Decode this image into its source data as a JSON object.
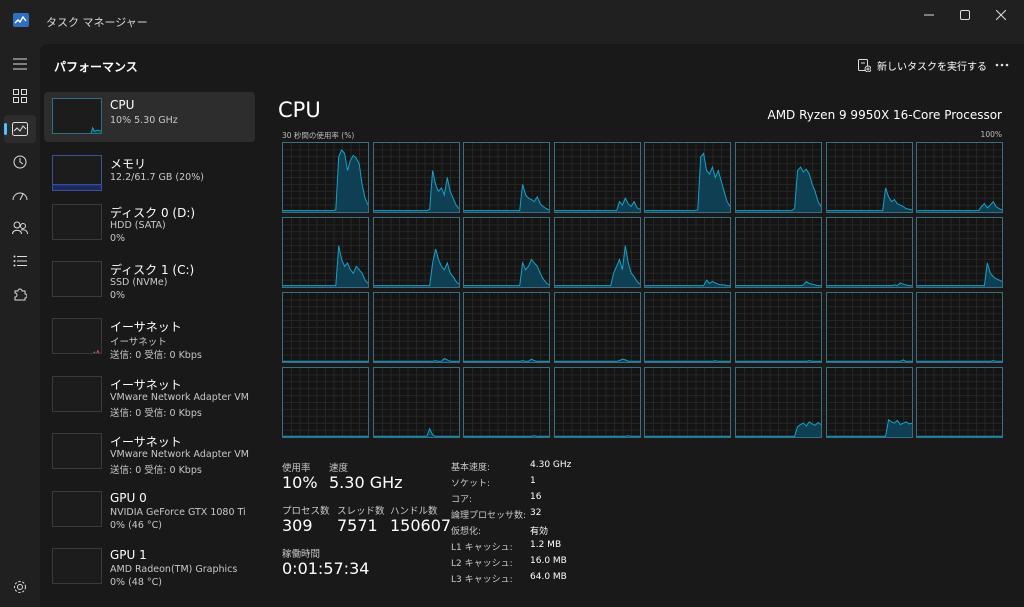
{
  "window": {
    "title": "タスク マネージャー"
  },
  "header": {
    "title": "パフォーマンス",
    "run_task_label": "新しいタスクを実行する"
  },
  "sidebar": {
    "items": [
      {
        "name": "CPU",
        "sub1": "10% 5.30 GHz",
        "sub2": ""
      },
      {
        "name": "メモリ",
        "sub1": "12.2/61.7 GB (20%)",
        "sub2": ""
      },
      {
        "name": "ディスク 0 (D:)",
        "sub1": "HDD (SATA)",
        "sub2": "0%"
      },
      {
        "name": "ディスク 1 (C:)",
        "sub1": "SSD (NVMe)",
        "sub2": "0%"
      },
      {
        "name": "イーサネット",
        "sub1": "イーサネット",
        "sub2": "送信: 0 受信: 0 Kbps"
      },
      {
        "name": "イーサネット",
        "sub1": "VMware Network Adapter VM...",
        "sub2": "送信: 0 受信: 0 Kbps"
      },
      {
        "name": "イーサネット",
        "sub1": "VMware Network Adapter VM...",
        "sub2": "送信: 0 受信: 0 Kbps"
      },
      {
        "name": "GPU 0",
        "sub1": "NVIDIA GeForce GTX 1080 Ti",
        "sub2": "0% (46 °C)"
      },
      {
        "name": "GPU 1",
        "sub1": "AMD Radeon(TM) Graphics",
        "sub2": "0% (48 °C)"
      }
    ]
  },
  "main": {
    "title": "CPU",
    "model": "AMD Ryzen 9 9950X 16-Core Processor",
    "graph_label_left": "30 秒間の使用率 (%)",
    "graph_label_right": "100%"
  },
  "stats": {
    "usage_label": "使用率",
    "usage_value": "10%",
    "speed_label": "速度",
    "speed_value": "5.30 GHz",
    "processes_label": "プロセス数",
    "processes_value": "309",
    "threads_label": "スレッド数",
    "threads_value": "7571",
    "handles_label": "ハンドル数",
    "handles_value": "150607",
    "uptime_label": "稼働時間",
    "uptime_value": "0:01:57:34"
  },
  "specs": [
    {
      "key": "基本速度:",
      "value": "4.30 GHz"
    },
    {
      "key": "ソケット:",
      "value": "1"
    },
    {
      "key": "コア:",
      "value": "16"
    },
    {
      "key": "論理プロセッサ数:",
      "value": "32"
    },
    {
      "key": "仮想化:",
      "value": "有効"
    },
    {
      "key": "L1 キャッシュ:",
      "value": "1.2 MB"
    },
    {
      "key": "L2 キャッシュ:",
      "value": "16.0 MB"
    },
    {
      "key": "L3 キャッシュ:",
      "value": "64.0 MB"
    }
  ],
  "colors": {
    "cpu_line": "#17a0c8",
    "cpu_fill": "#0f3f52",
    "memory": "#3a5ccc",
    "network": "#c85078",
    "accent": "#4cc2ff"
  },
  "cpu_cores": [
    [
      2,
      2,
      2,
      2,
      2,
      2,
      2,
      2,
      2,
      2,
      2,
      2,
      2,
      2,
      2,
      2,
      2,
      2,
      3,
      80,
      90,
      85,
      60,
      75,
      82,
      78,
      70,
      40,
      20,
      10
    ],
    [
      2,
      2,
      2,
      2,
      2,
      2,
      2,
      2,
      2,
      2,
      2,
      2,
      2,
      2,
      2,
      2,
      2,
      2,
      2,
      4,
      60,
      40,
      30,
      35,
      25,
      50,
      30,
      20,
      10,
      5
    ],
    [
      2,
      2,
      2,
      2,
      2,
      2,
      2,
      2,
      2,
      2,
      2,
      2,
      2,
      2,
      2,
      2,
      2,
      2,
      2,
      2,
      40,
      25,
      20,
      18,
      15,
      22,
      12,
      8,
      5,
      3
    ],
    [
      2,
      2,
      2,
      2,
      2,
      2,
      2,
      2,
      2,
      2,
      2,
      2,
      2,
      2,
      2,
      2,
      2,
      2,
      2,
      2,
      2,
      2,
      15,
      10,
      20,
      12,
      8,
      15,
      6,
      4
    ],
    [
      2,
      2,
      2,
      2,
      2,
      2,
      2,
      2,
      2,
      2,
      2,
      2,
      2,
      2,
      2,
      2,
      2,
      2,
      3,
      80,
      85,
      60,
      55,
      65,
      50,
      60,
      45,
      30,
      15,
      8
    ],
    [
      2,
      2,
      2,
      2,
      2,
      2,
      2,
      2,
      2,
      2,
      2,
      2,
      2,
      2,
      2,
      2,
      2,
      2,
      2,
      2,
      5,
      60,
      65,
      58,
      62,
      55,
      40,
      30,
      15,
      8
    ],
    [
      2,
      2,
      2,
      2,
      2,
      2,
      2,
      2,
      2,
      2,
      2,
      2,
      2,
      2,
      2,
      2,
      2,
      2,
      2,
      2,
      35,
      22,
      15,
      18,
      12,
      10,
      8,
      5,
      4,
      3
    ],
    [
      2,
      2,
      2,
      2,
      2,
      2,
      2,
      2,
      2,
      2,
      2,
      2,
      2,
      2,
      2,
      2,
      2,
      2,
      2,
      2,
      2,
      2,
      8,
      12,
      6,
      10,
      15,
      8,
      5,
      3
    ],
    [
      2,
      2,
      2,
      2,
      2,
      2,
      2,
      2,
      2,
      2,
      2,
      2,
      2,
      2,
      2,
      2,
      2,
      2,
      2,
      60,
      40,
      30,
      35,
      25,
      20,
      30,
      25,
      20,
      10,
      5
    ],
    [
      2,
      2,
      2,
      2,
      2,
      2,
      2,
      2,
      2,
      2,
      2,
      2,
      2,
      2,
      2,
      2,
      2,
      2,
      2,
      2,
      35,
      55,
      40,
      30,
      25,
      35,
      20,
      15,
      8,
      4
    ],
    [
      2,
      2,
      2,
      2,
      2,
      2,
      2,
      2,
      2,
      2,
      2,
      2,
      2,
      2,
      2,
      2,
      2,
      2,
      2,
      2,
      35,
      25,
      30,
      40,
      35,
      30,
      20,
      12,
      6,
      3
    ],
    [
      2,
      2,
      2,
      2,
      2,
      2,
      2,
      2,
      2,
      2,
      2,
      2,
      2,
      2,
      2,
      2,
      2,
      2,
      2,
      2,
      20,
      30,
      40,
      25,
      60,
      35,
      20,
      15,
      8,
      4
    ],
    [
      2,
      2,
      2,
      2,
      2,
      2,
      2,
      2,
      2,
      2,
      2,
      2,
      2,
      2,
      2,
      2,
      2,
      2,
      2,
      2,
      2,
      10,
      5,
      8,
      6,
      4,
      3,
      3,
      2,
      2
    ],
    [
      2,
      2,
      2,
      2,
      2,
      2,
      2,
      2,
      2,
      2,
      2,
      2,
      2,
      2,
      2,
      2,
      2,
      2,
      2,
      2,
      2,
      2,
      2,
      3,
      8,
      5,
      4,
      3,
      2,
      2
    ],
    [
      2,
      2,
      2,
      2,
      2,
      2,
      2,
      2,
      2,
      2,
      2,
      2,
      2,
      2,
      2,
      2,
      2,
      2,
      2,
      2,
      2,
      2,
      2,
      3,
      2,
      6,
      4,
      3,
      2,
      2
    ],
    [
      2,
      2,
      2,
      2,
      2,
      2,
      2,
      2,
      2,
      2,
      2,
      2,
      2,
      2,
      2,
      2,
      2,
      2,
      2,
      2,
      2,
      2,
      2,
      2,
      35,
      20,
      15,
      12,
      10,
      8
    ],
    [
      1,
      1,
      1,
      1,
      1,
      1,
      1,
      1,
      1,
      1,
      1,
      1,
      1,
      1,
      1,
      1,
      1,
      1,
      1,
      1,
      1,
      1,
      1,
      1,
      1,
      1,
      1,
      1,
      1,
      1
    ],
    [
      1,
      1,
      1,
      1,
      1,
      1,
      1,
      1,
      1,
      1,
      1,
      1,
      1,
      1,
      1,
      1,
      1,
      1,
      1,
      1,
      1,
      2,
      1,
      1,
      5,
      3,
      1,
      1,
      1,
      1
    ],
    [
      1,
      1,
      1,
      1,
      1,
      1,
      1,
      1,
      1,
      1,
      1,
      1,
      1,
      1,
      1,
      1,
      1,
      1,
      1,
      1,
      2,
      1,
      1,
      4,
      2,
      1,
      1,
      1,
      1,
      1
    ],
    [
      1,
      1,
      1,
      1,
      1,
      1,
      1,
      1,
      1,
      1,
      1,
      1,
      1,
      1,
      1,
      1,
      1,
      1,
      1,
      1,
      1,
      1,
      2,
      4,
      3,
      1,
      1,
      1,
      1,
      1
    ],
    [
      1,
      1,
      1,
      1,
      1,
      1,
      1,
      1,
      1,
      1,
      1,
      1,
      1,
      1,
      1,
      1,
      1,
      1,
      1,
      1,
      1,
      1,
      1,
      1,
      2,
      1,
      1,
      1,
      1,
      1
    ],
    [
      1,
      1,
      1,
      1,
      1,
      1,
      1,
      1,
      1,
      1,
      1,
      1,
      1,
      1,
      1,
      1,
      1,
      1,
      1,
      1,
      1,
      1,
      1,
      1,
      1,
      2,
      1,
      1,
      1,
      1
    ],
    [
      1,
      1,
      1,
      1,
      1,
      1,
      1,
      1,
      1,
      1,
      1,
      1,
      1,
      1,
      1,
      1,
      1,
      1,
      1,
      1,
      1,
      1,
      1,
      1,
      1,
      1,
      3,
      1,
      1,
      1
    ],
    [
      1,
      1,
      1,
      1,
      1,
      1,
      1,
      1,
      1,
      1,
      1,
      1,
      1,
      1,
      1,
      1,
      1,
      1,
      1,
      1,
      1,
      1,
      1,
      1,
      1,
      1,
      2,
      1,
      1,
      1
    ],
    [
      1,
      1,
      1,
      1,
      1,
      1,
      1,
      1,
      1,
      1,
      1,
      1,
      1,
      1,
      1,
      1,
      1,
      1,
      1,
      1,
      1,
      1,
      1,
      1,
      1,
      1,
      1,
      1,
      1,
      1
    ],
    [
      1,
      1,
      1,
      1,
      1,
      1,
      1,
      1,
      1,
      1,
      1,
      1,
      1,
      1,
      1,
      1,
      1,
      1,
      1,
      12,
      3,
      1,
      1,
      1,
      1,
      1,
      1,
      1,
      1,
      1
    ],
    [
      1,
      1,
      1,
      1,
      1,
      1,
      1,
      1,
      1,
      1,
      1,
      1,
      1,
      1,
      1,
      1,
      1,
      1,
      1,
      1,
      1,
      1,
      1,
      1,
      2,
      1,
      1,
      1,
      1,
      1
    ],
    [
      1,
      1,
      1,
      1,
      1,
      1,
      1,
      1,
      1,
      1,
      1,
      1,
      1,
      1,
      1,
      1,
      1,
      1,
      1,
      1,
      1,
      1,
      1,
      1,
      1,
      2,
      1,
      1,
      1,
      1
    ],
    [
      1,
      1,
      1,
      1,
      1,
      1,
      1,
      1,
      1,
      1,
      1,
      1,
      1,
      1,
      1,
      1,
      1,
      1,
      1,
      1,
      1,
      1,
      1,
      1,
      1,
      1,
      1,
      1,
      1,
      1
    ],
    [
      1,
      1,
      1,
      1,
      1,
      1,
      1,
      1,
      1,
      1,
      1,
      1,
      1,
      1,
      1,
      1,
      1,
      1,
      1,
      1,
      1,
      15,
      18,
      20,
      16,
      22,
      19,
      17,
      21,
      18
    ],
    [
      1,
      1,
      1,
      1,
      1,
      1,
      1,
      1,
      1,
      1,
      1,
      1,
      1,
      1,
      1,
      1,
      1,
      1,
      1,
      1,
      1,
      25,
      22,
      20,
      24,
      18,
      20,
      22,
      19,
      20
    ],
    [
      1,
      1,
      1,
      1,
      1,
      1,
      1,
      1,
      1,
      1,
      1,
      1,
      1,
      1,
      1,
      1,
      1,
      1,
      1,
      1,
      1,
      1,
      1,
      1,
      1,
      1,
      1,
      1,
      1,
      1
    ]
  ],
  "thumb_cpu": [
    2,
    2,
    2,
    2,
    2,
    2,
    2,
    2,
    2,
    2,
    2,
    2,
    2,
    2,
    2,
    2,
    2,
    2,
    2,
    2,
    2,
    2,
    2,
    20,
    10,
    12,
    14,
    11,
    12,
    10
  ],
  "thumb_memory": [
    20,
    20,
    20,
    20,
    20,
    20,
    20,
    20,
    20,
    20,
    20,
    20,
    20,
    20,
    20,
    20,
    20,
    20,
    20,
    20,
    20,
    20,
    20,
    20,
    20,
    20,
    20,
    20,
    20,
    20
  ],
  "thumb_net": [
    0,
    0,
    0,
    0,
    0,
    0,
    0,
    0,
    0,
    0,
    0,
    0,
    0,
    0,
    0,
    0,
    0,
    0,
    0,
    0,
    0,
    0,
    0,
    0,
    8,
    0,
    12,
    0,
    6,
    0
  ]
}
